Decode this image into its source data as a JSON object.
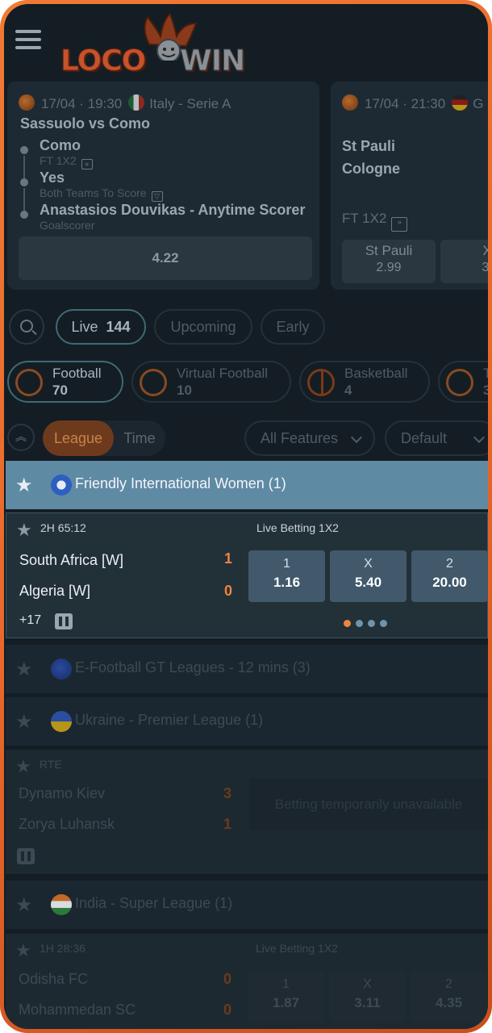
{
  "header": {
    "logo_left": "LOCO",
    "logo_right": "WIN"
  },
  "featured": [
    {
      "datetime": "17/04 · 19:30",
      "league": "Italy - Serie A",
      "title": "Sassuolo vs Como",
      "legs": [
        {
          "pick": "Como",
          "market": "FT 1X2"
        },
        {
          "pick": "Yes",
          "market": "Both Teams To Score"
        },
        {
          "pick": "Anastasios Douvikas - Anytime Scorer",
          "market": "Goalscorer"
        }
      ],
      "odds": "4.22"
    },
    {
      "datetime": "17/04 · 21:30",
      "league": "G",
      "home": "St Pauli",
      "away": "Cologne",
      "market": "FT 1X2",
      "picks": [
        {
          "name": "St Pauli",
          "odds": "2.99"
        },
        {
          "name": "X",
          "odds": "3."
        }
      ]
    }
  ],
  "filters": {
    "live_label": "Live",
    "live_count": "144",
    "upcoming_label": "Upcoming",
    "early_label": "Early"
  },
  "sports": [
    {
      "name": "Football",
      "count": "70"
    },
    {
      "name": "Virtual Football",
      "count": "10"
    },
    {
      "name": "Basketball",
      "count": "4"
    },
    {
      "name": "T",
      "count": "3"
    }
  ],
  "sortbar": {
    "league": "League",
    "time": "Time",
    "features": "All Features",
    "sort": "Default"
  },
  "leagues": {
    "friendly": "Friendly International Women (1)",
    "efootball": "E-Football GT Leagues - 12 mins (3)",
    "ukraine": "Ukraine - Premier League (1)",
    "india": "India - Super League (1)"
  },
  "matches": {
    "m1": {
      "clock": "2H   65:12",
      "market": "Live Betting 1X2",
      "home": "South Africa [W]",
      "away": "Algeria [W]",
      "home_score": "1",
      "away_score": "0",
      "odds": [
        {
          "label": "1",
          "value": "1.16"
        },
        {
          "label": "X",
          "value": "5.40"
        },
        {
          "label": "2",
          "value": "20.00"
        }
      ],
      "more": "+17"
    },
    "m2": {
      "clock": "RTE",
      "home": "Dynamo Kiev",
      "away": "Zorya Luhansk",
      "home_score": "3",
      "away_score": "1",
      "unavailable": "Betting temporarily unavailable"
    },
    "m3": {
      "clock": "1H   28:36",
      "market": "Live Betting 1X2",
      "home": "Odisha FC",
      "away": "Mohammedan SC",
      "home_score": "0",
      "away_score": "0",
      "odds": [
        {
          "label": "1",
          "value": "1.87"
        },
        {
          "label": "X",
          "value": "3.11"
        },
        {
          "label": "2",
          "value": "4.35"
        }
      ]
    }
  },
  "colors": {
    "accent": "#ef8440",
    "highlight": "#5f8aa4",
    "background": "#141d24"
  }
}
